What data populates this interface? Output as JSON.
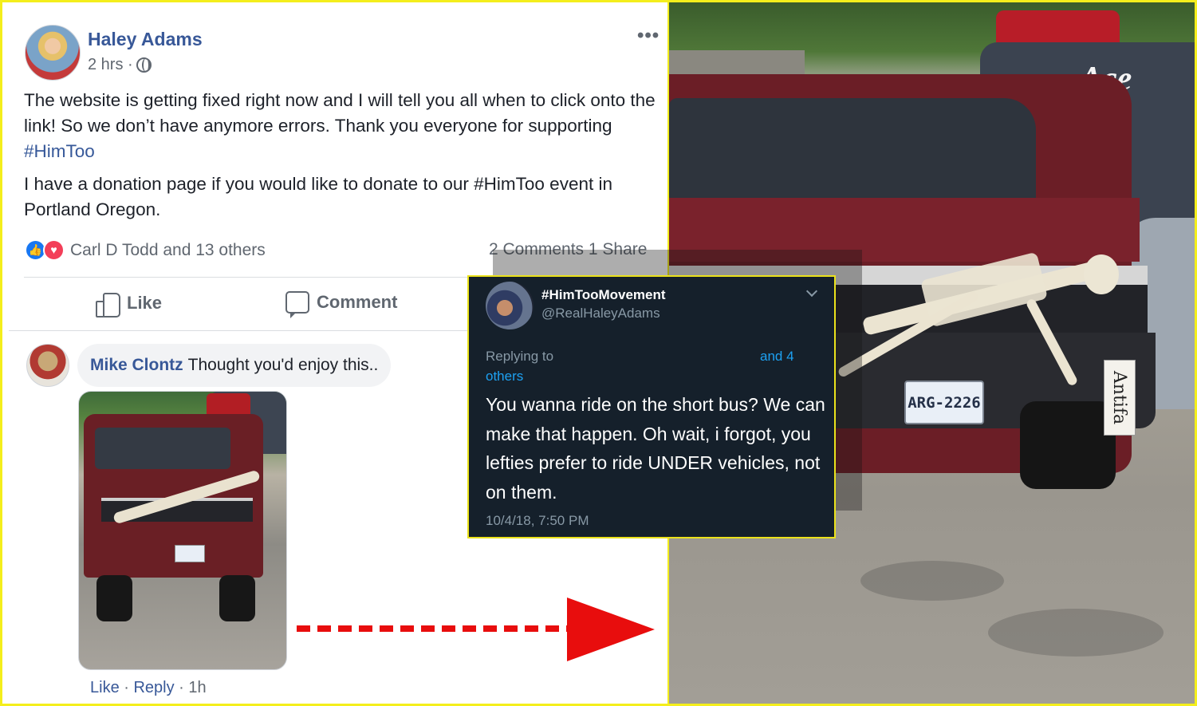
{
  "facebook": {
    "post": {
      "author": "Haley Adams",
      "time": "2 hrs · ",
      "text_1_pre": "The website is getting fixed right now and I will tell you all when to click onto the link! So we don’t have anymore errors. Thank you everyone for supporting ",
      "text_1_hashtag": "#HimToo",
      "text_2": "I have a donation page if you would like to donate to our #HimToo event in Portland Oregon.",
      "reactions_names": "Carl D Todd and 13 others",
      "counts": "2 Comments  1 Share",
      "more": "•••"
    },
    "actions": {
      "like": "Like",
      "comment": "Comment"
    },
    "comment": {
      "author": "Mike Clontz",
      "text": "Thought you'd enjoy this..",
      "like": "Like",
      "separator_1": " · ",
      "reply": "Reply",
      "time": " · 1h"
    }
  },
  "tweet": {
    "display_name": "#HimTooMovement",
    "handle": "@RealHaleyAdams",
    "replying_to": "Replying to",
    "and_n": "and 4",
    "others": "others",
    "body": "You wanna ride on the short bus?  We can make that happen.  Oh wait, i forgot, you lefties  prefer to ride UNDER vehicles, not on them.",
    "timestamp": "10/4/18, 7:50 PM"
  },
  "photo": {
    "brand_logo": "Ace",
    "plate": "ARG-2226",
    "sign": "Antifa"
  },
  "colors": {
    "frame": "#f4ee1c",
    "fb_link": "#385898",
    "tweet_bg": "#15202b",
    "tweet_link": "#1da1f2",
    "arrow": "#e80d0d"
  }
}
